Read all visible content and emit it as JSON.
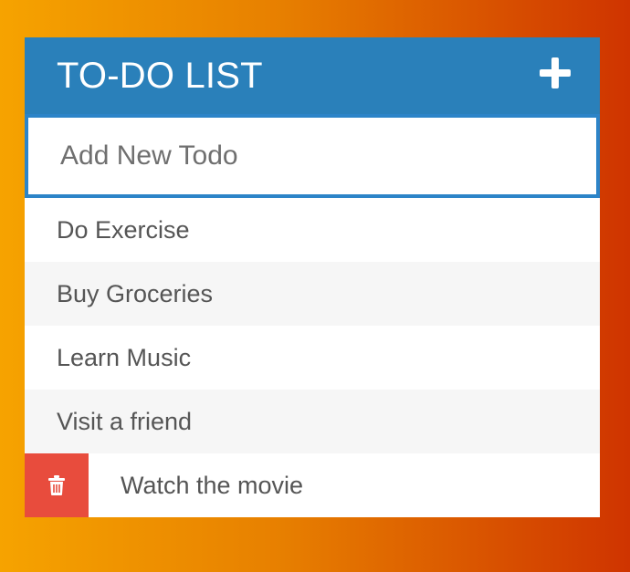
{
  "header": {
    "title": "TO-DO LIST",
    "add_icon": "plus-icon"
  },
  "input": {
    "placeholder": "Add New Todo",
    "value": ""
  },
  "todos": [
    {
      "text": "Do Exercise"
    },
    {
      "text": "Buy Groceries"
    },
    {
      "text": "Learn Music"
    },
    {
      "text": "Visit a friend"
    },
    {
      "text": "Watch the movie",
      "hovered": true,
      "delete_icon": "trash-icon"
    }
  ],
  "colors": {
    "header_bg": "#2a80ba",
    "input_border": "#2c84c8",
    "delete_bg": "#e84c3d",
    "row_alt_bg": "#f6f6f6",
    "background_gradient_start": "#f6a300",
    "background_gradient_end": "#cf3400"
  }
}
